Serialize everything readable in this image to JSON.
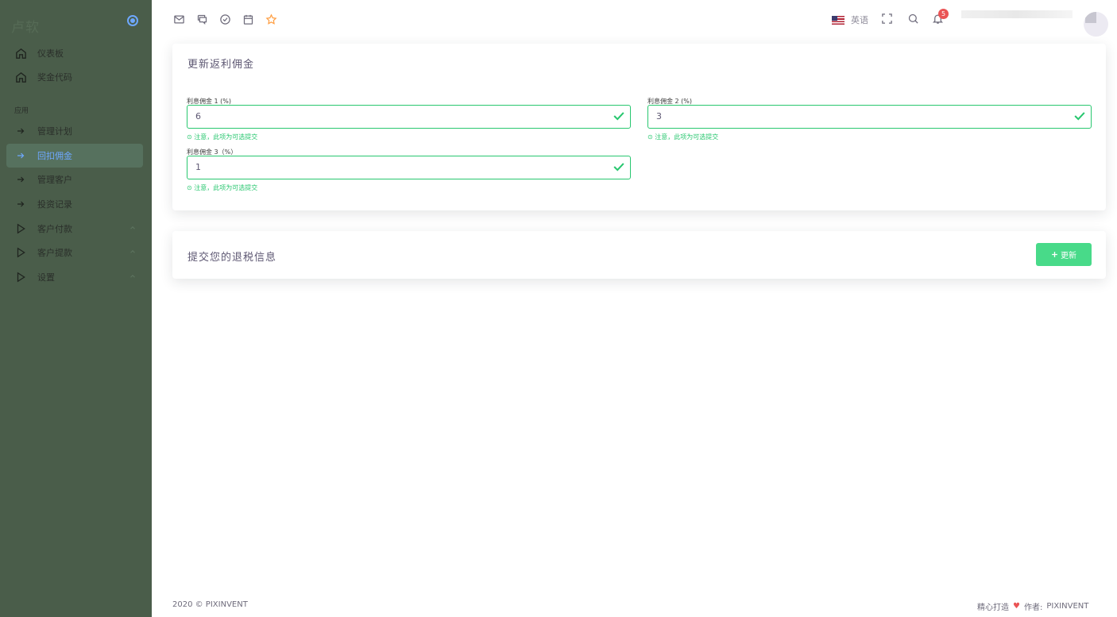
{
  "sidebar": {
    "brand": "卢软",
    "section_label": "应用",
    "items": [
      {
        "label": "仪表板",
        "icon": "home-icon"
      },
      {
        "label": "奖金代码",
        "icon": "home-icon"
      },
      {
        "label": "管理计划",
        "icon": "arrow-right-icon"
      },
      {
        "label": "回扣佣金",
        "icon": "arrow-right-icon",
        "active": true
      },
      {
        "label": "管理客户",
        "icon": "arrow-right-icon"
      },
      {
        "label": "投资记录",
        "icon": "arrow-right-icon"
      },
      {
        "label": "客户付款",
        "icon": "play-icon"
      },
      {
        "label": "客户提款",
        "icon": "play-icon"
      },
      {
        "label": "设置",
        "icon": "play-icon"
      }
    ]
  },
  "topbar": {
    "icons": [
      "mail-icon",
      "chat-icon",
      "check-circle-icon",
      "calendar-icon",
      "star-icon"
    ],
    "language": "英语",
    "notification_count": "5"
  },
  "form_card": {
    "title": "更新返利佣金",
    "fields": [
      {
        "label": "利息佣金 1 (%)",
        "value": "6",
        "hint": "⊙ 注意，此项为可选提交"
      },
      {
        "label": "利息佣金 2 (%)",
        "value": "3",
        "hint": "⊙ 注意，此项为可选提交"
      },
      {
        "label": "利息佣金 3（%）",
        "value": "1",
        "hint": "⊙ 注意，此项为可选提交"
      }
    ]
  },
  "submit_card": {
    "title": "提交您的退税信息",
    "button_label": "更新"
  },
  "footer": {
    "copyright": "2020 © PIXINVENT",
    "made_with": "精心打造",
    "author_label": "作者:",
    "author": "PIXINVENT"
  },
  "colors": {
    "sidebar_bg": "#4a5d4a",
    "active_text": "#6ea8fe",
    "success": "#28c76f",
    "button": "#48da89",
    "badge": "#ea5455",
    "star": "#ff9f43"
  }
}
